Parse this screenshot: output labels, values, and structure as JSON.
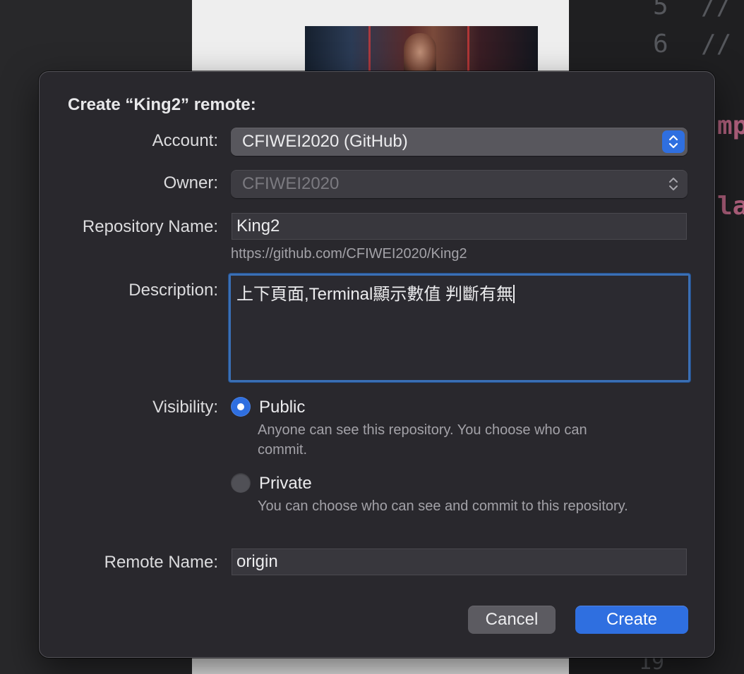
{
  "background": {
    "line_numbers": [
      "5",
      "6",
      "19"
    ],
    "code_fragments": [
      "//",
      "//",
      "mp",
      "la"
    ]
  },
  "dialog": {
    "title": "Create “King2” remote:",
    "account": {
      "label": "Account:",
      "value": "CFIWEI2020 (GitHub)"
    },
    "owner": {
      "label": "Owner:",
      "value": "CFIWEI2020"
    },
    "repository": {
      "label": "Repository Name:",
      "value": "King2",
      "url": "https://github.com/CFIWEI2020/King2"
    },
    "description": {
      "label": "Description:",
      "value": "上下頁面,Terminal顯示數值 判斷有無"
    },
    "visibility": {
      "label": "Visibility:",
      "selected": "Public",
      "options": [
        {
          "label": "Public",
          "help": "Anyone can see this repository. You choose who can commit."
        },
        {
          "label": "Private",
          "help": "You can choose who can see and commit to this repository."
        }
      ]
    },
    "remote": {
      "label": "Remote Name:",
      "value": "origin"
    },
    "buttons": {
      "cancel": "Cancel",
      "create": "Create"
    }
  },
  "colors": {
    "accent": "#2f6fe0",
    "dialog_bg": "#29282d",
    "focus_ring": "#3a6fb5"
  }
}
